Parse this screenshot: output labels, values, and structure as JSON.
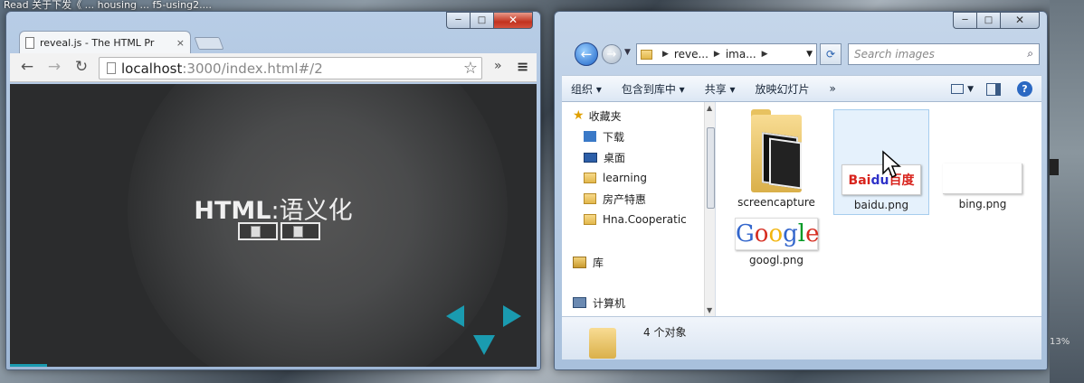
{
  "desktop": {
    "title_fragment": "Read   关于下发《 ... housing ... f5-using2...."
  },
  "chrome": {
    "tab_title": "reveal.js - The HTML Pr",
    "tab_close": "×",
    "url_host": "localhost",
    "url_path": ":3000/index.html#/2",
    "overflow_label": "»",
    "menu_label": "≡",
    "slide": {
      "title_latin": "HTML",
      "title_cjk": ":语义化",
      "progress_fraction": 0.07
    },
    "window_controls": {
      "minimize": "─",
      "maximize": "□",
      "close": "✕"
    }
  },
  "explorer": {
    "window_controls": {
      "minimize": "─",
      "maximize": "□",
      "close": "✕"
    },
    "breadcrumb": [
      "reve...",
      "ima..."
    ],
    "search_placeholder": "Search images",
    "toolbar": {
      "organize": "组织 ▾",
      "include": "包含到库中 ▾",
      "share": "共享 ▾",
      "slideshow": "放映幻灯片",
      "more": "»"
    },
    "nav": {
      "favorites": "收藏夹",
      "downloads": "下载",
      "desktop": "桌面",
      "learning": "learning",
      "housing": "房产特惠",
      "hna": "Hna.Cooperatic",
      "library": "库",
      "computer": "计算机"
    },
    "files": [
      {
        "name": "screencapture"
      },
      {
        "name": "baidu.png"
      },
      {
        "name": "bing.png"
      },
      {
        "name": "googl.png"
      }
    ],
    "thumbs": {
      "baidu_text_a": "Bai",
      "baidu_text_b": "du",
      "baidu_text_c": "百度",
      "google_text": "Google"
    },
    "item_count": "4 个对象"
  },
  "right_strip": {
    "percent": "13%"
  },
  "colors": {
    "reveal_accent": "#1a9bb0",
    "explorer_blue": "#2b68c2"
  }
}
